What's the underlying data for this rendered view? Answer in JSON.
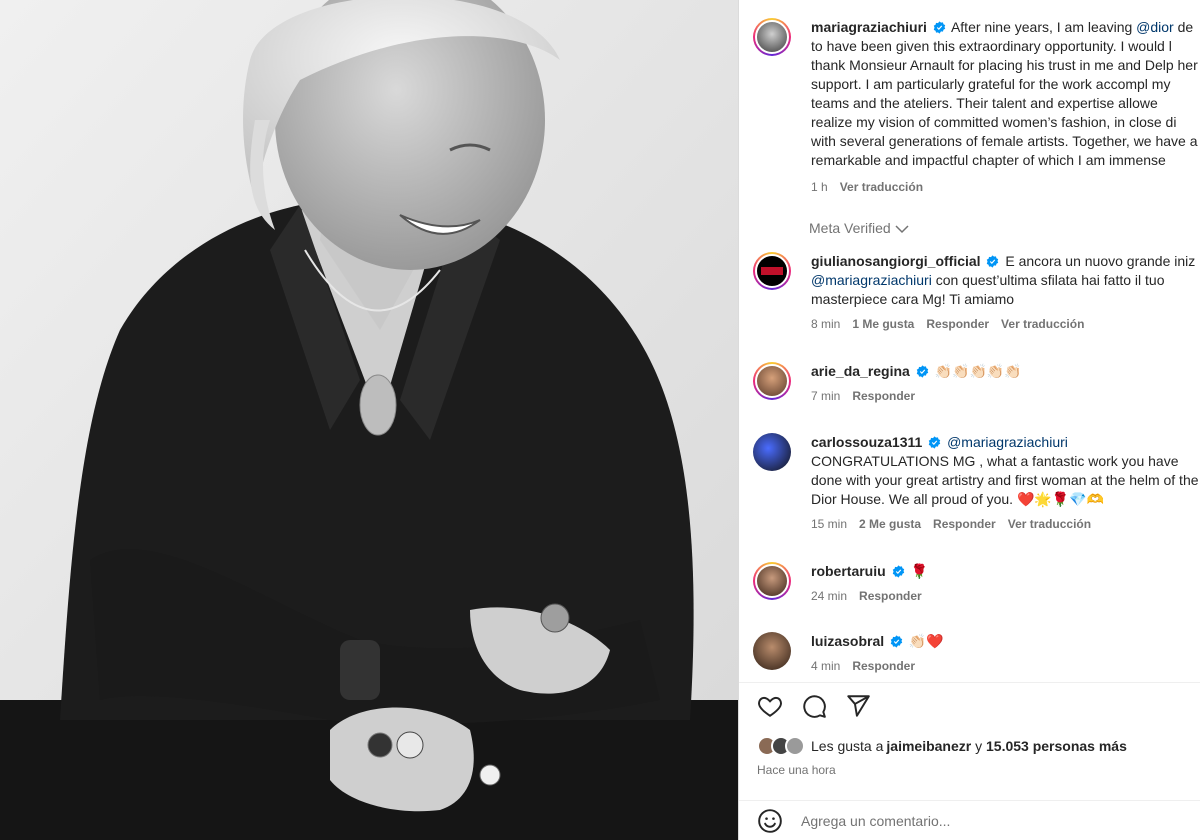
{
  "post": {
    "author": "mariagraziachiuri",
    "caption_intro": "After nine years, I am leaving ",
    "caption_mention": "@dior",
    "caption_rest": " de to have been given this extraordinary opportunity. I would l thank Monsieur Arnault for placing his trust in me and Delp her support. I am particularly grateful for the work accompl my teams and the ateliers. Their talent and expertise allowe realize my vision of committed women’s fashion, in close di with several generations of female artists. Together, we have a remarkable and impactful chapter of which I am immense",
    "time": "1 h",
    "translate": "Ver traducción",
    "meta_verified": "Meta Verified"
  },
  "comments": [
    {
      "user": "giulianosangiorgi_official",
      "text_a": " E ancora un nuovo grande iniz",
      "mention": "@mariagraziachiuri",
      "text_b": " con quest’ultima sfilata hai fatto il tuo masterpiece cara Mg! Ti amiamo",
      "time": "8 min",
      "likes": "1 Me gusta",
      "reply": "Responder",
      "translate": "Ver traducción"
    },
    {
      "user": "arie_da_regina",
      "text_a": " 👏🏻👏🏻👏🏻👏🏻👏🏻",
      "time": "7 min",
      "reply": "Responder"
    },
    {
      "user": "carlossouza1311",
      "mention": "@mariagraziachiuri",
      "text_b": " CONGRATULATIONS MG , what a fantastic work you have done with your great artistry and first woman at the helm of the Dior House. We all proud of you. ❤️🌟🌹💎🫶",
      "time": "15 min",
      "likes": "2 Me gusta",
      "reply": "Responder",
      "translate": "Ver traducción"
    },
    {
      "user": "robertaruiu",
      "text_a": " 🌹",
      "time": "24 min",
      "reply": "Responder"
    },
    {
      "user": "luizasobral",
      "text_a": " 👏🏻❤️",
      "time": "4 min",
      "reply": "Responder"
    }
  ],
  "likes_bar": {
    "prefix": "Les gusta a ",
    "user": "jaimeibanezr",
    "middle": " y ",
    "count": "15.053 personas más"
  },
  "time_ago": "Hace una hora",
  "comment_input": {
    "placeholder": "Agrega un comentario..."
  },
  "icons": {
    "like": "heart-icon",
    "comment": "comment-icon",
    "share": "share-icon",
    "emoji": "emoji-icon",
    "verified": "verified-badge-icon",
    "chevron": "chevron-down-icon"
  },
  "colors": {
    "verified": "#0095f6",
    "mention": "#00376b",
    "secondary": "#737373"
  }
}
